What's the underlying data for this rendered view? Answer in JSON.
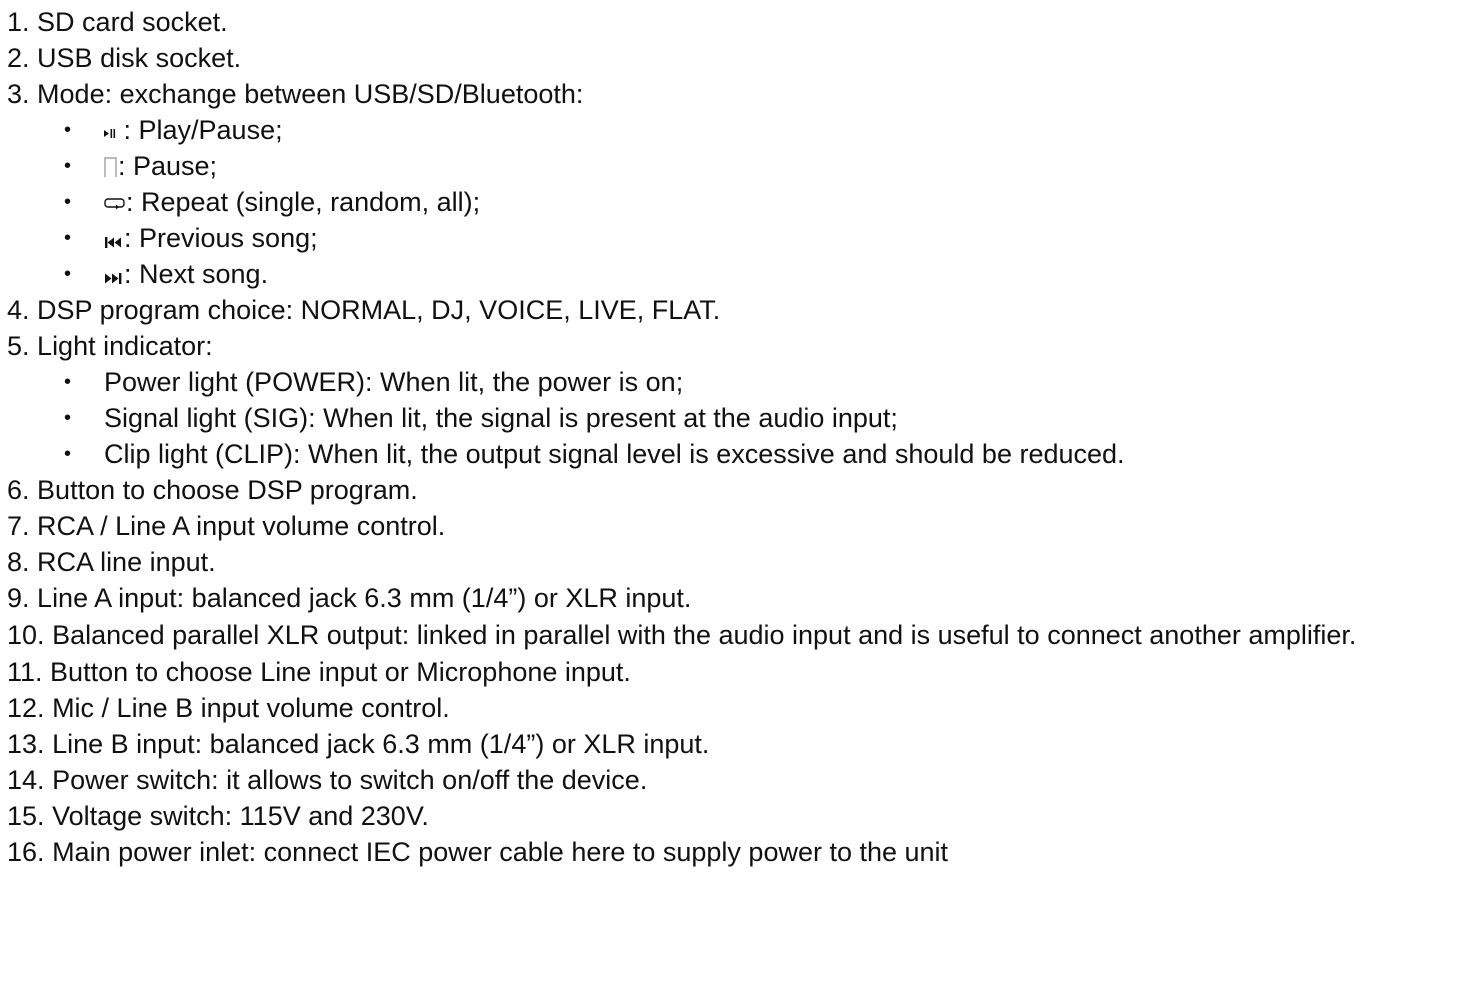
{
  "items": [
    {
      "num": "1.",
      "text": "SD card socket."
    },
    {
      "num": "2.",
      "text": "USB disk socket."
    },
    {
      "num": "3.",
      "text": "Mode: exchange between USB/SD/Bluetooth:"
    },
    {
      "num": "4.",
      "text": "DSP program choice: NORMAL, DJ, VOICE, LIVE, FLAT."
    },
    {
      "num": "5.",
      "text": "Light indicator:"
    },
    {
      "num": "6.",
      "text": "Button to choose DSP program."
    },
    {
      "num": "7.",
      "text": "RCA / Line A input volume control."
    },
    {
      "num": "8.",
      "text": "RCA line input."
    },
    {
      "num": "9.",
      "text": "Line A input: balanced jack 6.3 mm (1/4”) or XLR input."
    },
    {
      "num": "10.",
      "text": "Balanced parallel XLR output: linked in parallel with the audio input and is useful to connect another amplifier."
    },
    {
      "num": "11.",
      "text": "Button to choose Line input or Microphone input."
    },
    {
      "num": "12.",
      "text": "Mic / Line B input volume control."
    },
    {
      "num": "13.",
      "text": "Line B input: balanced jack 6.3 mm (1/4”) or XLR input."
    },
    {
      "num": "14.",
      "text": "Power switch: it allows to switch on/off the device."
    },
    {
      "num": "15.",
      "text": "Voltage switch: 115V and 230V."
    },
    {
      "num": "16.",
      "text": "Main power inlet: connect IEC power cable here to supply power to the unit"
    }
  ],
  "mode_bullets": [
    {
      "icon": "play-pause-icon",
      "text": " : Play/Pause;"
    },
    {
      "icon": "pause-icon",
      "text": ": Pause;"
    },
    {
      "icon": "repeat-icon",
      "text": ": Repeat (single, random, all);"
    },
    {
      "icon": "previous-icon",
      "text": ": Previous song;"
    },
    {
      "icon": "next-icon",
      "text": ": Next song."
    }
  ],
  "light_bullets": [
    {
      "text": "Power light (POWER): When lit, the power is on;"
    },
    {
      "text": "Signal light (SIG): When lit, the signal is present at the audio input;"
    },
    {
      "text": "Clip light (CLIP): When lit, the output signal level is excessive and should be reduced."
    }
  ],
  "bullet_glyph": "•"
}
